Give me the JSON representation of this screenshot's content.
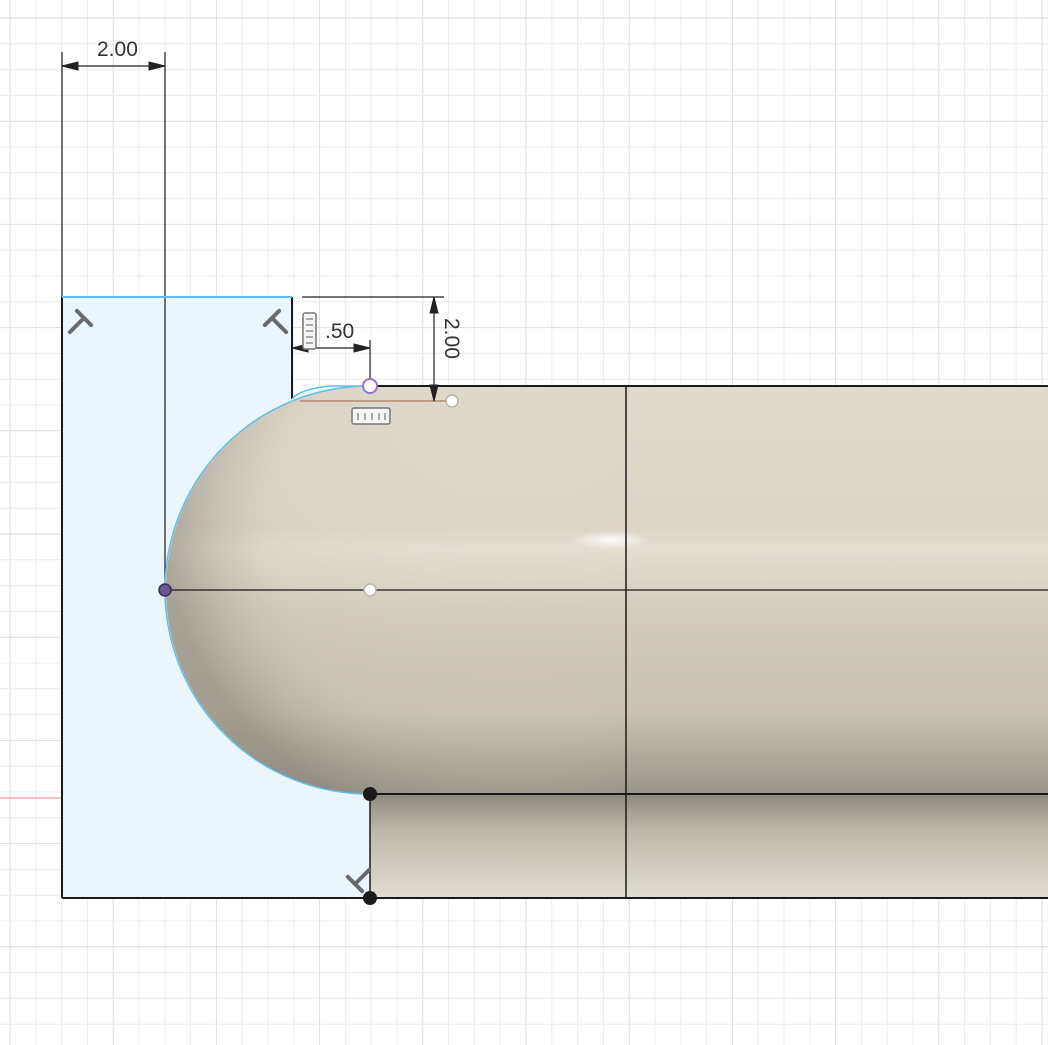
{
  "colors": {
    "grid_minor": "#ececec",
    "grid_major": "#dedede",
    "selection_fill": "#eaf4fc",
    "selection_edge": "#5fbfe8",
    "body_base": "#ddd6c8",
    "body_shadow": "#8f8a80",
    "sketch_line": "#1a1a1a",
    "x_axis": "#e88a8a",
    "point_purple": "#9b6fd1",
    "dimension_line": "#222222"
  },
  "icons": {
    "perpendicular": "perpendicular-constraint-icon",
    "tangent": "tangent-constraint-icon",
    "horizontal": "horizontal-constraint-icon"
  },
  "dimensions": {
    "top_width": "2.00",
    "vertical_offset": "2.00",
    "small_offset": ".50"
  }
}
